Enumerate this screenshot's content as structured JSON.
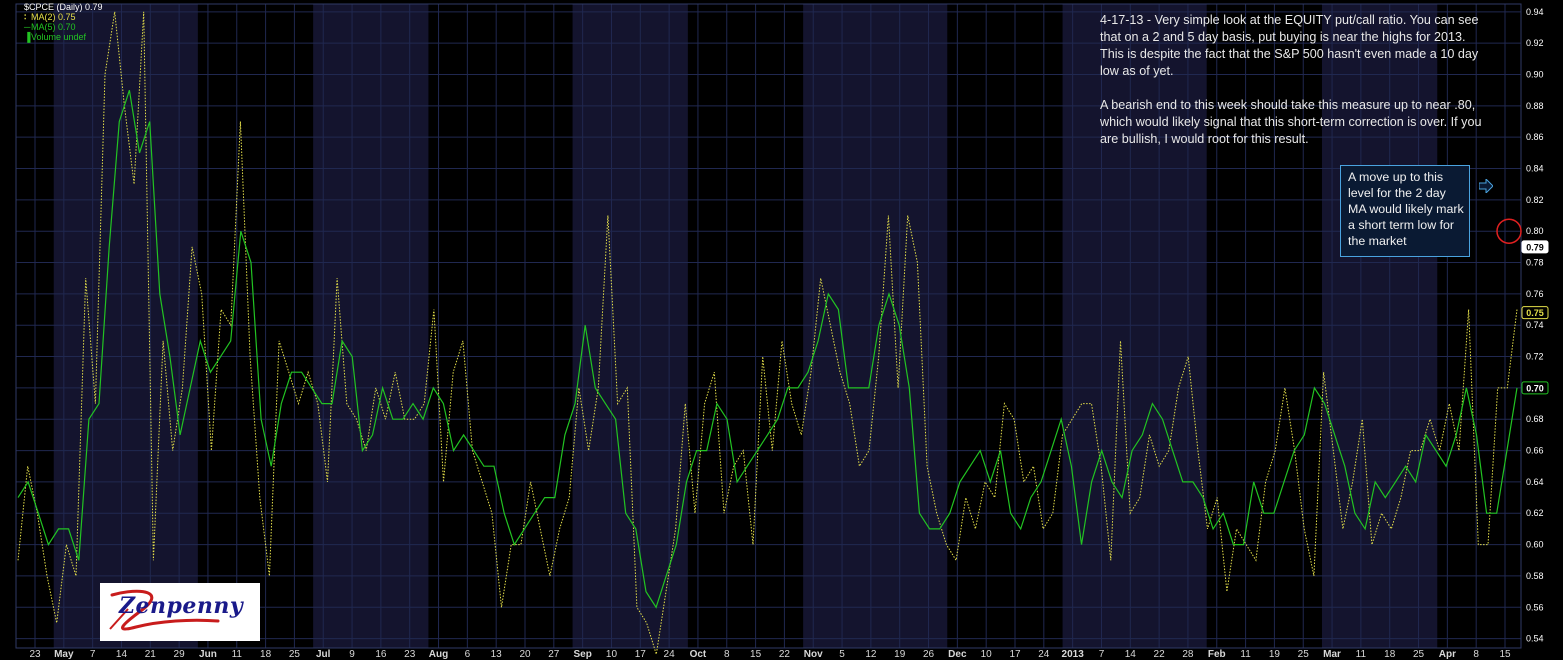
{
  "chart_data": {
    "type": "line",
    "symbol_label": "$CPCE (Daily) 0.79",
    "y_ticks": [
      "0.54",
      "0.56",
      "0.58",
      "0.60",
      "0.62",
      "0.64",
      "0.66",
      "0.68",
      "0.70",
      "0.72",
      "0.74",
      "0.76",
      "0.78",
      "0.80",
      "0.82",
      "0.84",
      "0.86",
      "0.88",
      "0.90",
      "0.92",
      "0.94"
    ],
    "ylim": [
      0.534,
      0.945
    ],
    "x_ticks": [
      {
        "label": "23",
        "bold": false,
        "band": "dark"
      },
      {
        "label": "May",
        "bold": true,
        "band": "shade"
      },
      {
        "label": "7",
        "bold": false,
        "band": "shade"
      },
      {
        "label": "14",
        "bold": false,
        "band": "shade"
      },
      {
        "label": "21",
        "bold": false,
        "band": "shade"
      },
      {
        "label": "29",
        "bold": false,
        "band": "shade"
      },
      {
        "label": "Jun",
        "bold": true,
        "band": "dark"
      },
      {
        "label": "11",
        "bold": false,
        "band": "dark"
      },
      {
        "label": "18",
        "bold": false,
        "band": "dark"
      },
      {
        "label": "25",
        "bold": false,
        "band": "dark"
      },
      {
        "label": "Jul",
        "bold": true,
        "band": "shade"
      },
      {
        "label": "9",
        "bold": false,
        "band": "shade"
      },
      {
        "label": "16",
        "bold": false,
        "band": "shade"
      },
      {
        "label": "23",
        "bold": false,
        "band": "shade"
      },
      {
        "label": "Aug",
        "bold": true,
        "band": "dark"
      },
      {
        "label": "6",
        "bold": false,
        "band": "dark"
      },
      {
        "label": "13",
        "bold": false,
        "band": "dark"
      },
      {
        "label": "20",
        "bold": false,
        "band": "dark"
      },
      {
        "label": "27",
        "bold": false,
        "band": "dark"
      },
      {
        "label": "Sep",
        "bold": true,
        "band": "shade"
      },
      {
        "label": "10",
        "bold": false,
        "band": "shade"
      },
      {
        "label": "17",
        "bold": false,
        "band": "shade"
      },
      {
        "label": "24",
        "bold": false,
        "band": "shade"
      },
      {
        "label": "Oct",
        "bold": true,
        "band": "dark"
      },
      {
        "label": "8",
        "bold": false,
        "band": "dark"
      },
      {
        "label": "15",
        "bold": false,
        "band": "dark"
      },
      {
        "label": "22",
        "bold": false,
        "band": "dark"
      },
      {
        "label": "Nov",
        "bold": true,
        "band": "shade"
      },
      {
        "label": "5",
        "bold": false,
        "band": "shade"
      },
      {
        "label": "12",
        "bold": false,
        "band": "shade"
      },
      {
        "label": "19",
        "bold": false,
        "band": "shade"
      },
      {
        "label": "26",
        "bold": false,
        "band": "shade"
      },
      {
        "label": "Dec",
        "bold": true,
        "band": "dark"
      },
      {
        "label": "10",
        "bold": false,
        "band": "dark"
      },
      {
        "label": "17",
        "bold": false,
        "band": "dark"
      },
      {
        "label": "24",
        "bold": false,
        "band": "dark"
      },
      {
        "label": "2013",
        "bold": true,
        "band": "shade"
      },
      {
        "label": "7",
        "bold": false,
        "band": "shade"
      },
      {
        "label": "14",
        "bold": false,
        "band": "shade"
      },
      {
        "label": "22",
        "bold": false,
        "band": "shade"
      },
      {
        "label": "28",
        "bold": false,
        "band": "shade"
      },
      {
        "label": "Feb",
        "bold": true,
        "band": "dark"
      },
      {
        "label": "11",
        "bold": false,
        "band": "dark"
      },
      {
        "label": "19",
        "bold": false,
        "band": "dark"
      },
      {
        "label": "25",
        "bold": false,
        "band": "dark"
      },
      {
        "label": "Mar",
        "bold": true,
        "band": "shade"
      },
      {
        "label": "11",
        "bold": false,
        "band": "shade"
      },
      {
        "label": "18",
        "bold": false,
        "band": "shade"
      },
      {
        "label": "25",
        "bold": false,
        "band": "shade"
      },
      {
        "label": "Apr",
        "bold": true,
        "band": "dark"
      },
      {
        "label": "8",
        "bold": false,
        "band": "dark"
      },
      {
        "label": "15",
        "bold": false,
        "band": "dark"
      }
    ],
    "series": [
      {
        "name": "MA(2) 0.75",
        "style": "dotted",
        "color": "#e5e04a",
        "values": [
          0.59,
          0.65,
          0.62,
          0.58,
          0.55,
          0.6,
          0.58,
          0.77,
          0.69,
          0.9,
          0.94,
          0.88,
          0.83,
          0.94,
          0.59,
          0.73,
          0.66,
          0.7,
          0.79,
          0.76,
          0.66,
          0.75,
          0.74,
          0.87,
          0.72,
          0.63,
          0.58,
          0.73,
          0.71,
          0.69,
          0.71,
          0.69,
          0.64,
          0.77,
          0.69,
          0.68,
          0.66,
          0.7,
          0.68,
          0.71,
          0.68,
          0.68,
          0.69,
          0.75,
          0.64,
          0.71,
          0.73,
          0.66,
          0.64,
          0.62,
          0.56,
          0.6,
          0.6,
          0.64,
          0.61,
          0.58,
          0.61,
          0.63,
          0.7,
          0.66,
          0.7,
          0.81,
          0.69,
          0.7,
          0.56,
          0.55,
          0.53,
          0.57,
          0.61,
          0.69,
          0.62,
          0.69,
          0.71,
          0.62,
          0.65,
          0.66,
          0.6,
          0.72,
          0.66,
          0.73,
          0.69,
          0.67,
          0.71,
          0.77,
          0.74,
          0.71,
          0.69,
          0.65,
          0.66,
          0.72,
          0.81,
          0.7,
          0.81,
          0.78,
          0.65,
          0.62,
          0.6,
          0.59,
          0.63,
          0.61,
          0.64,
          0.63,
          0.69,
          0.68,
          0.64,
          0.65,
          0.61,
          0.62,
          0.67,
          0.68,
          0.69,
          0.69,
          0.65,
          0.59,
          0.73,
          0.62,
          0.63,
          0.67,
          0.65,
          0.66,
          0.7,
          0.72,
          0.66,
          0.61,
          0.63,
          0.57,
          0.61,
          0.6,
          0.59,
          0.64,
          0.66,
          0.7,
          0.66,
          0.61,
          0.58,
          0.71,
          0.66,
          0.61,
          0.64,
          0.68,
          0.6,
          0.62,
          0.61,
          0.63,
          0.66,
          0.66,
          0.68,
          0.66,
          0.69,
          0.66,
          0.75,
          0.6,
          0.6,
          0.7,
          0.7,
          0.75
        ]
      },
      {
        "name": "MA(5) 0.70",
        "style": "solid",
        "color": "#22c322",
        "values": [
          0.63,
          0.64,
          0.62,
          0.6,
          0.61,
          0.61,
          0.59,
          0.68,
          0.69,
          0.79,
          0.87,
          0.89,
          0.85,
          0.87,
          0.76,
          0.72,
          0.67,
          0.7,
          0.73,
          0.71,
          0.72,
          0.73,
          0.8,
          0.78,
          0.68,
          0.65,
          0.69,
          0.71,
          0.71,
          0.7,
          0.69,
          0.69,
          0.73,
          0.72,
          0.66,
          0.67,
          0.7,
          0.68,
          0.68,
          0.69,
          0.68,
          0.7,
          0.69,
          0.66,
          0.67,
          0.66,
          0.65,
          0.65,
          0.62,
          0.6,
          0.61,
          0.62,
          0.63,
          0.63,
          0.67,
          0.69,
          0.74,
          0.7,
          0.69,
          0.68,
          0.62,
          0.61,
          0.57,
          0.56,
          0.58,
          0.6,
          0.64,
          0.66,
          0.66,
          0.69,
          0.68,
          0.64,
          0.65,
          0.66,
          0.67,
          0.68,
          0.7,
          0.7,
          0.71,
          0.73,
          0.76,
          0.75,
          0.7,
          0.7,
          0.7,
          0.74,
          0.76,
          0.74,
          0.7,
          0.62,
          0.61,
          0.61,
          0.62,
          0.64,
          0.65,
          0.66,
          0.64,
          0.66,
          0.62,
          0.61,
          0.63,
          0.64,
          0.66,
          0.68,
          0.65,
          0.6,
          0.64,
          0.66,
          0.64,
          0.63,
          0.66,
          0.67,
          0.69,
          0.68,
          0.66,
          0.64,
          0.64,
          0.63,
          0.61,
          0.62,
          0.6,
          0.6,
          0.64,
          0.62,
          0.62,
          0.64,
          0.66,
          0.67,
          0.7,
          0.69,
          0.67,
          0.65,
          0.62,
          0.61,
          0.64,
          0.63,
          0.64,
          0.65,
          0.64,
          0.67,
          0.66,
          0.65,
          0.67,
          0.7,
          0.67,
          0.62,
          0.62,
          0.66,
          0.7
        ]
      }
    ],
    "legend": [
      {
        "label": "$CPCE (Daily) 0.79",
        "color": "#ffffff",
        "marker": ""
      },
      {
        "label": "MA(2) 0.75",
        "color": "#e5e04a",
        "marker": "dots"
      },
      {
        "label": "MA(5) 0.70",
        "color": "#22c322",
        "marker": "line"
      },
      {
        "label": "Volume undef",
        "color": "#22c322",
        "marker": "bars"
      }
    ],
    "badges": [
      {
        "label": "0.79",
        "value": 0.79,
        "bg": "#ffffff",
        "fg": "#000000",
        "border": "#ffffff"
      },
      {
        "label": "0.75",
        "value": 0.748,
        "bg": "#000000",
        "fg": "#e5e04a",
        "border": "#e5e04a"
      },
      {
        "label": "0.70",
        "value": 0.7,
        "bg": "#000000",
        "fg": "#ffffff",
        "border": "#22c322"
      }
    ],
    "marker_circle_value": 0.8,
    "grid": true
  },
  "annotation": {
    "paragraph1": "4-17-13 - Very simple look at the EQUITY put/call ratio. You can see that on a 2 and 5 day basis, put buying is near the highs for 2013. This is despite the fact that the S&P 500 hasn't even made a 10 day low as of yet.",
    "paragraph2": "A bearish end to this week should take this measure up to near .80, which would likely signal that this short-term correction is over. If you are bullish, I would root for this result."
  },
  "callout": {
    "text": "A move up to this level for the 2 day MA would likely mark a short term low for the market"
  },
  "logo": {
    "text": "Zenpenny"
  },
  "colors": {
    "background": "#000000",
    "band_shade": "#14142e",
    "grid": "#202850",
    "callout_border": "#4aa3df",
    "marker_circle": "#e02020"
  }
}
